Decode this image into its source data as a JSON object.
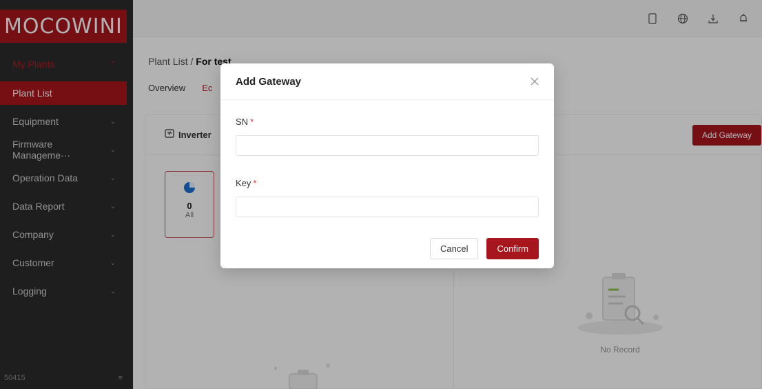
{
  "brand": {
    "logo_text": "MOCOWINI",
    "accent": "#a8161d"
  },
  "sidebar": {
    "items": [
      {
        "label": "My Plants",
        "state": "group-open",
        "has_chevron": true
      },
      {
        "label": "Plant List",
        "state": "active",
        "has_chevron": false
      },
      {
        "label": "Equipment",
        "has_chevron": true
      },
      {
        "label": "Firmware Manageme···",
        "has_chevron": true
      },
      {
        "label": "Operation Data",
        "has_chevron": true
      },
      {
        "label": "Data Report",
        "has_chevron": true
      },
      {
        "label": "Company",
        "has_chevron": true
      },
      {
        "label": "Customer",
        "has_chevron": true
      },
      {
        "label": "Logging",
        "has_chevron": true
      }
    ],
    "footer_text": "50415",
    "footer_icon": "collapse-menu-icon"
  },
  "topbar": {
    "icons": [
      "tablet-icon",
      "globe-icon",
      "download-icon",
      "bell-icon"
    ]
  },
  "breadcrumb": {
    "parent": "Plant List",
    "separator": "/",
    "current": "For test"
  },
  "subtabs": [
    {
      "label": "Overview"
    },
    {
      "label": "Ec",
      "active": true
    }
  ],
  "card": {
    "title": "Inverter",
    "add_button": "Add Gateway",
    "stat": {
      "count": "0",
      "label": "All"
    },
    "empty_text": "No Record"
  },
  "modal": {
    "title": "Add Gateway",
    "fields": [
      {
        "label": "SN",
        "required_mark": "*",
        "value": "",
        "placeholder": ""
      },
      {
        "label": "Key",
        "required_mark": "*",
        "value": "",
        "placeholder": ""
      }
    ],
    "cancel_label": "Cancel",
    "confirm_label": "Confirm"
  }
}
